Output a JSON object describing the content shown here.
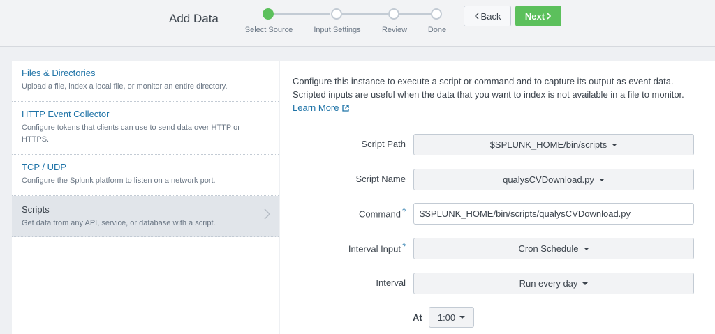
{
  "header": {
    "title": "Add Data",
    "steps": [
      {
        "label": "Select Source",
        "active": true
      },
      {
        "label": "Input Settings",
        "active": false
      },
      {
        "label": "Review",
        "active": false
      },
      {
        "label": "Done",
        "active": false
      }
    ],
    "back_label": "Back",
    "next_label": "Next",
    "accent_color": "#5cc05c"
  },
  "sources": [
    {
      "name": "Files & Directories",
      "desc": "Upload a file, index a local file, or monitor an entire directory."
    },
    {
      "name": "HTTP Event Collector",
      "desc": "Configure tokens that clients can use to send data over HTTP or HTTPS."
    },
    {
      "name": "TCP / UDP",
      "desc": "Configure the Splunk platform to listen on a network port."
    },
    {
      "name": "Scripts",
      "desc": "Get data from any API, service, or database with a script.",
      "selected": true
    }
  ],
  "form": {
    "intro": "Configure this instance to execute a script or command and to capture its output as event data. Scripted inputs are useful when the data that you want to index is not available in a file to monitor.",
    "learn_more": "Learn More",
    "script_path_label": "Script Path",
    "script_path_value": "$SPLUNK_HOME/bin/scripts",
    "script_name_label": "Script Name",
    "script_name_value": "qualysCVDownload.py",
    "command_label": "Command",
    "command_value": "$SPLUNK_HOME/bin/scripts/qualysCVDownload.py",
    "interval_input_label": "Interval Input",
    "interval_input_value": "Cron Schedule",
    "interval_label": "Interval",
    "interval_value": "Run every day",
    "at_label": "At",
    "at_value": "1:00",
    "help_mark": "?"
  }
}
